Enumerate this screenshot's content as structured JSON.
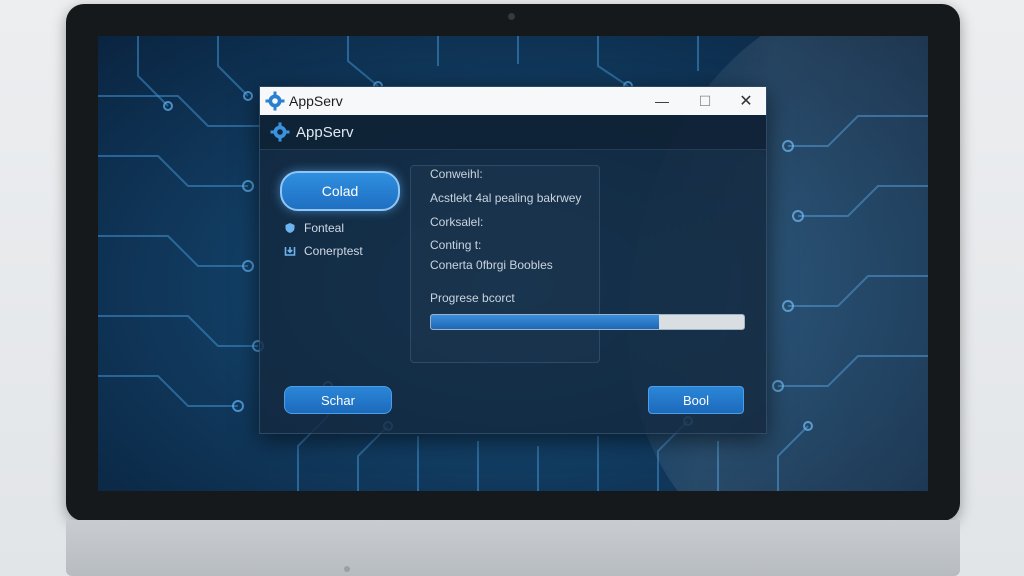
{
  "window": {
    "title": "AppServ",
    "minimize_glyph": "—",
    "maximize_glyph": "☐",
    "close_glyph": "✕"
  },
  "header": {
    "title": "AppServ",
    "icon": "gear-icon"
  },
  "sidebar": {
    "primary_button": "Colad",
    "items": [
      {
        "label": "Fonteal",
        "icon": "shield-icon"
      },
      {
        "label": "Conerptest",
        "icon": "download-icon"
      }
    ]
  },
  "info": {
    "lines": [
      "Conweihl:",
      "Acstlekt 4al pealing  bakrwey",
      "Corksalel:",
      "Conting t:",
      "Conerta 0fbrgi Boobles"
    ],
    "progress_label": "Progrese bcorct",
    "progress_value": 0.73
  },
  "footer": {
    "left_button": "Schar",
    "right_button": "Bool"
  },
  "colors": {
    "accent": "#2f8fe0",
    "window_bg": "#14283e",
    "screen_bg": "#123e64"
  }
}
